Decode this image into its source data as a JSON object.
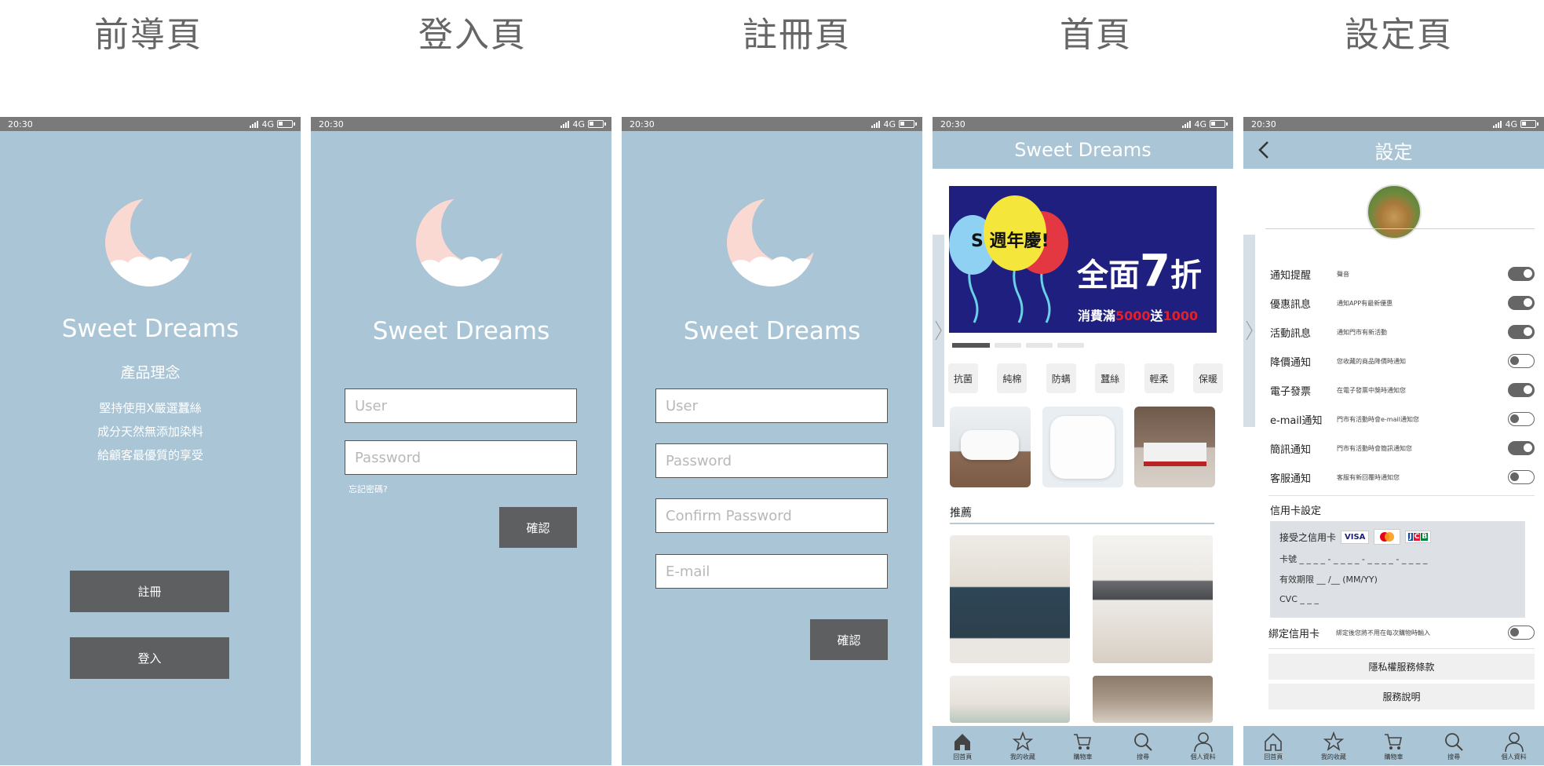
{
  "titles": [
    "前導頁",
    "登入頁",
    "註冊頁",
    "首頁",
    "設定頁"
  ],
  "status": {
    "time": "20:30",
    "network": "4G"
  },
  "brand": "Sweet Dreams",
  "splash": {
    "concept_title": "產品理念",
    "concept_lines": [
      "堅持使用X嚴選蠶絲",
      "成分天然無添加染料",
      "給顧客最優質的享受"
    ],
    "register_label": "註冊",
    "login_label": "登入"
  },
  "login": {
    "user_placeholder": "User",
    "password_placeholder": "Password",
    "forgot": "忘記密碼?",
    "confirm_label": "確認"
  },
  "register": {
    "user_placeholder": "User",
    "password_placeholder": "Password",
    "confirm_password_placeholder": "Confirm Password",
    "email_placeholder": "E-mail",
    "confirm_label": "確認"
  },
  "home": {
    "header": "Sweet Dreams",
    "banner": {
      "anniv": "S 週年慶!",
      "headline_prefix": "全面",
      "headline_num": "7",
      "headline_suffix": "折",
      "promo_a": "消費滿",
      "promo_b": "5000",
      "promo_c": "送",
      "promo_d": "1000",
      "bg_color": "#1e1f7e",
      "promo_color": "#e2202b"
    },
    "categories": [
      "抗菌",
      "純棉",
      "防螨",
      "蠶絲",
      "輕柔",
      "保暖"
    ],
    "recommend_label": "推薦"
  },
  "tabbar": [
    {
      "label": "回首頁",
      "icon": "home-icon"
    },
    {
      "label": "我的收藏",
      "icon": "star-icon"
    },
    {
      "label": "購物車",
      "icon": "cart-icon"
    },
    {
      "label": "搜尋",
      "icon": "search-icon"
    },
    {
      "label": "個人資料",
      "icon": "user-icon"
    }
  ],
  "settings": {
    "header": "設定",
    "rows": [
      {
        "label": "通知提醒",
        "desc": "聲音",
        "on": true
      },
      {
        "label": "優惠訊息",
        "desc": "通知APP有最新優惠",
        "on": true
      },
      {
        "label": "活動訊息",
        "desc": "通知門市有新活動",
        "on": true
      },
      {
        "label": "降價通知",
        "desc": "您收藏的商品降價時通知",
        "on": false
      },
      {
        "label": "電子發票",
        "desc": "在電子發票中獎時通知您",
        "on": true
      },
      {
        "label": "e-mail通知",
        "desc": "門市有活動時會e-mail通知您",
        "on": false
      },
      {
        "label": "簡訊通知",
        "desc": "門市有活動時會簡訊通知您",
        "on": true
      },
      {
        "label": "客服通知",
        "desc": "客服有新回覆時通知您",
        "on": false
      }
    ],
    "card_title": "信用卡設定",
    "card_accept": "接受之信用卡",
    "card_no": "卡號 _ _ _ _ - _ _ _ _ - _ _ _ _ - _ _ _ _",
    "card_expiry": "有效期限 __ /__ (MM/YY)",
    "card_cvc": "CVC _ _ _",
    "bind_label": "綁定信用卡",
    "bind_desc": "綁定後您將不用在每次購物時輸入",
    "bind_on": false,
    "privacy": "隱私權服務條款",
    "service": "服務說明",
    "card_brands": [
      "VISA",
      "Mastercard",
      "JCB"
    ]
  },
  "colors": {
    "screen_bg": "#aac5d6",
    "status_bar": "#7a7a7a",
    "button_dark": "#5e5f61",
    "moon": "#fbd9d3"
  }
}
